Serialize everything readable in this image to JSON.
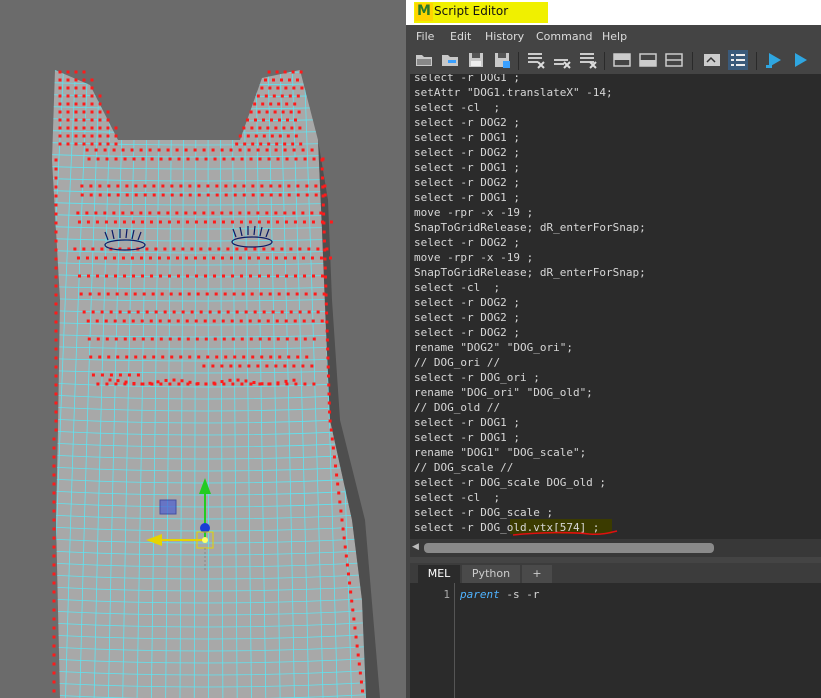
{
  "window": {
    "title": "Script Editor",
    "logo_letter": "M"
  },
  "menu": [
    "File",
    "Edit",
    "History",
    "Command",
    "Help"
  ],
  "toolbar_icons": [
    "open-script-icon",
    "source-script-icon",
    "save-script-icon",
    "save-script-to-shelf-icon",
    "clear-history-icon",
    "clear-input-icon",
    "clear-all-icon",
    "show-history-icon",
    "show-input-icon",
    "show-both-icon",
    "echo-all-commands-icon",
    "line-numbers-icon",
    "execute-all-icon",
    "execute-icon"
  ],
  "history_lines": [
    "select -r DOG1 ;",
    "setAttr \"DOG1.translateX\" -14;",
    "select -cl  ;",
    "select -r DOG2 ;",
    "select -r DOG1 ;",
    "select -r DOG2 ;",
    "select -r DOG1 ;",
    "select -r DOG2 ;",
    "select -r DOG1 ;",
    "move -rpr -x -19 ;",
    "SnapToGridRelease; dR_enterForSnap;",
    "select -r DOG2 ;",
    "move -rpr -x -19 ;",
    "SnapToGridRelease; dR_enterForSnap;",
    "select -cl  ;",
    "select -r DOG2 ;",
    "select -r DOG2 ;",
    "select -r DOG2 ;",
    "rename \"DOG2\" \"DOG_ori\";",
    "// DOG_ori //",
    "select -r DOG_ori ;",
    "rename \"DOG_ori\" \"DOG_old\";",
    "// DOG_old //",
    "select -r DOG1 ;",
    "select -r DOG1 ;",
    "rename \"DOG1\" \"DOG_scale\";",
    "// DOG_scale //",
    "select -r DOG_scale DOG_old ;",
    "select -cl  ;",
    "select -r DOG_scale ;",
    "select -r DOG_old.vtx[574] ;"
  ],
  "tabs": [
    "MEL",
    "Python",
    "+"
  ],
  "input": {
    "line_number": "1",
    "keyword": "parent",
    "rest": " -s -r"
  },
  "colors": {
    "wire": "#5fe3f0",
    "vertex": "#ff1a1a",
    "title_highlight": "#f0f000",
    "annotation_underline": "#e01010"
  }
}
